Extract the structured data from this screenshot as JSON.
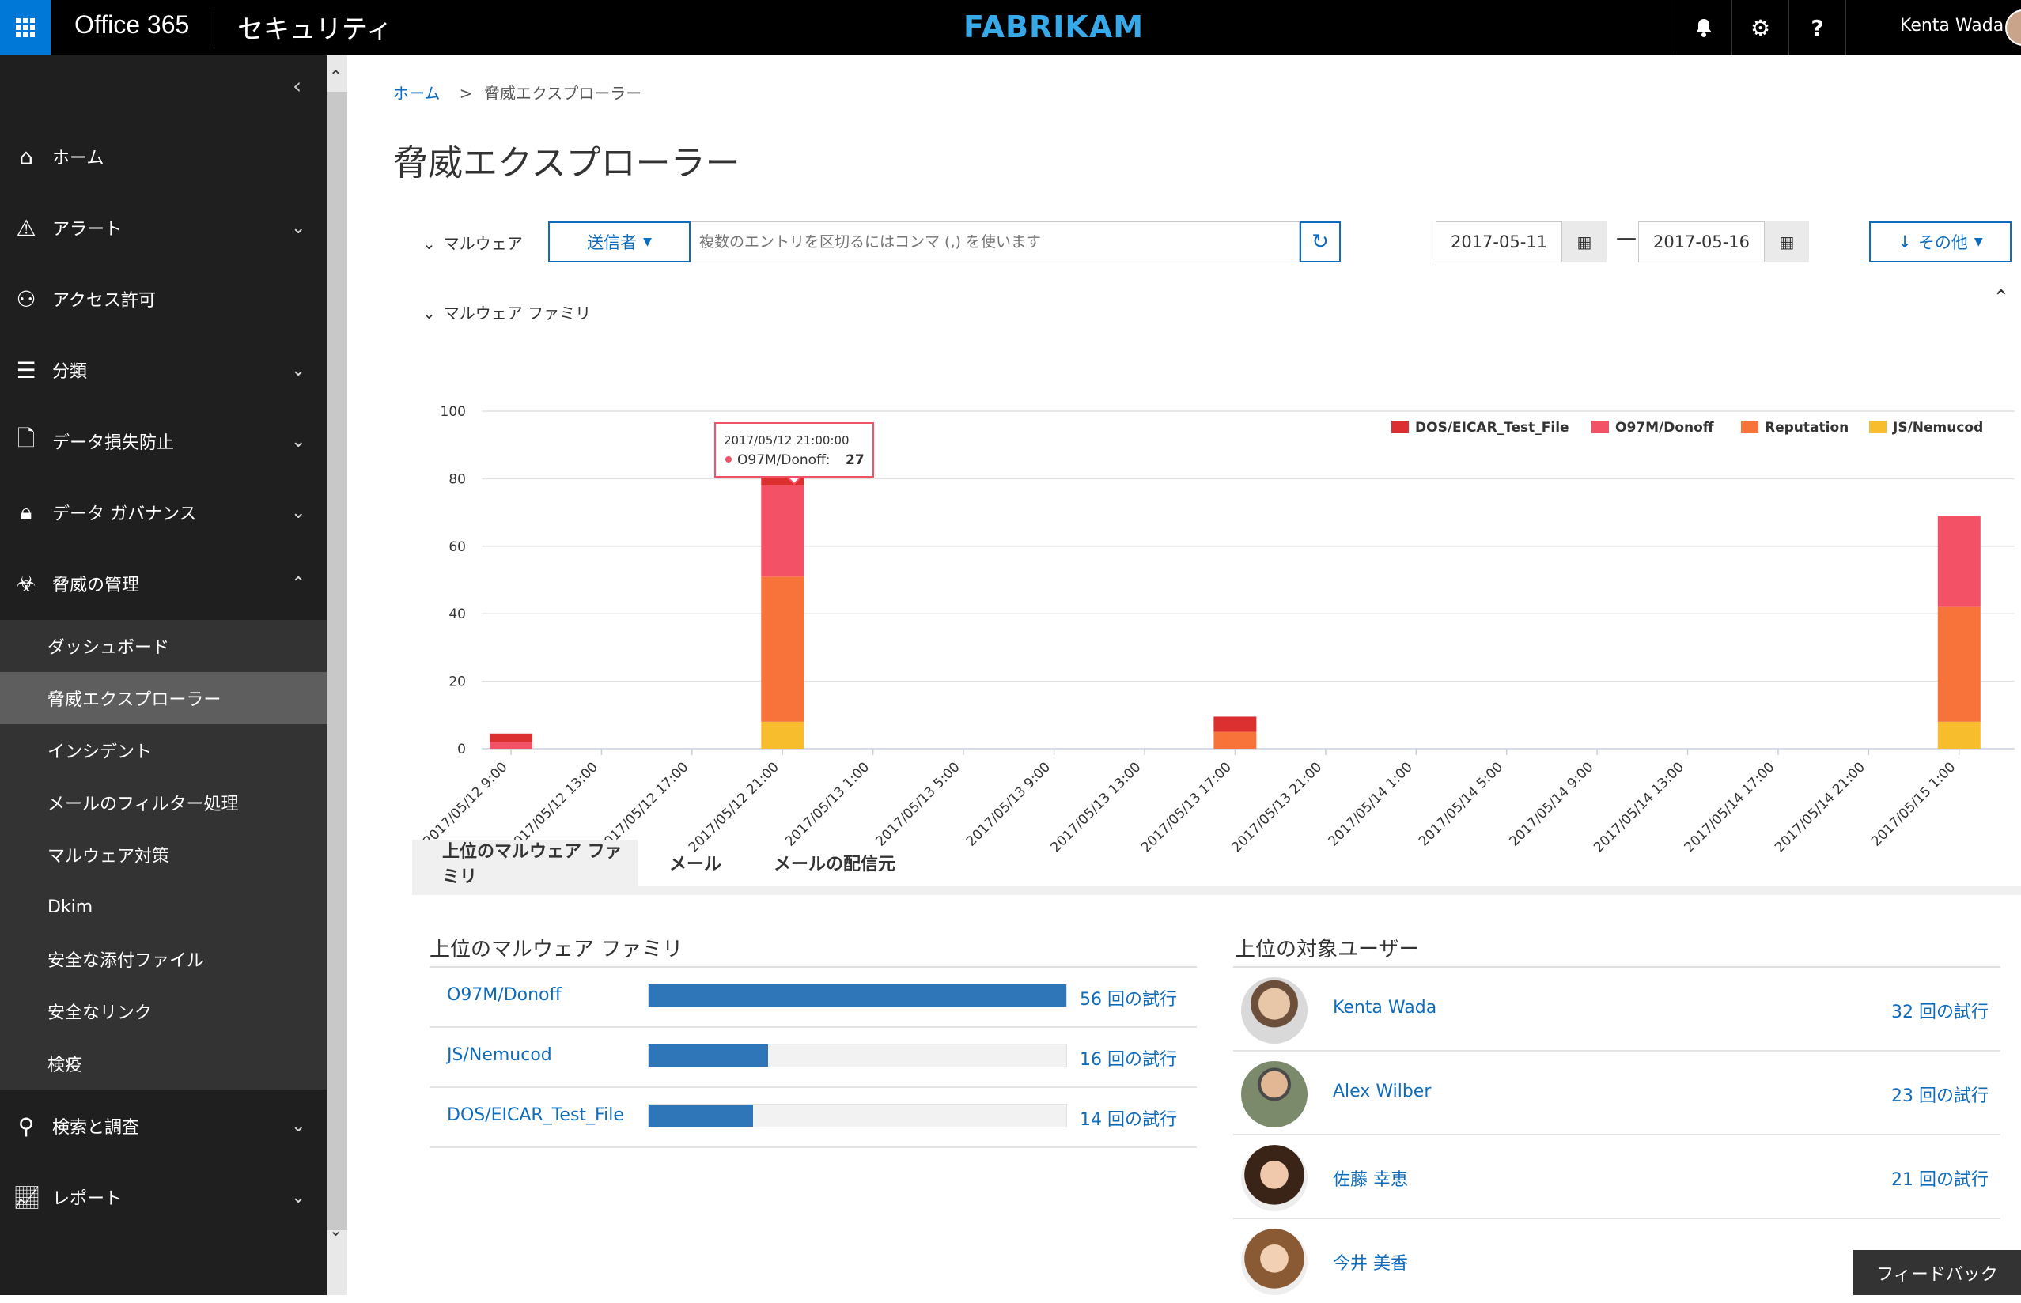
{
  "topbar": {
    "app_name": "Office 365",
    "section_name": "セキュリティ",
    "brand": "FABRIKAM",
    "user_name": "Kenta Wada"
  },
  "sidebar": {
    "items": [
      {
        "label": "ホーム",
        "icon": "home-icon"
      },
      {
        "label": "アラート",
        "icon": "alert-icon"
      },
      {
        "label": "アクセス許可",
        "icon": "people-icon"
      },
      {
        "label": "分類",
        "icon": "list-icon"
      },
      {
        "label": "データ損失防止",
        "icon": "document-lock-icon"
      },
      {
        "label": "データ ガバナンス",
        "icon": "lock-icon"
      },
      {
        "label": "脅威の管理",
        "icon": "biohazard-icon"
      },
      {
        "label": "検索と調査",
        "icon": "search-icon"
      },
      {
        "label": "レポート",
        "icon": "chart-icon"
      }
    ],
    "subitems": [
      "ダッシュボード",
      "脅威エクスプローラー",
      "インシデント",
      "メールのフィルター処理",
      "マルウェア対策",
      "Dkim",
      "安全な添付ファイル",
      "安全なリンク",
      "検疫"
    ],
    "active_subitem": "脅威エクスプローラー"
  },
  "breadcrumb": {
    "home": "ホーム",
    "separator": ">",
    "current": "脅威エクスプローラー"
  },
  "page_title": "脅威エクスプローラー",
  "filter": {
    "toggle_label": "マルウェア",
    "sender_label": "送信者",
    "search_placeholder": "複数のエントリを区切るにはコンマ (,) を使います",
    "date_from": "2017-05-11",
    "date_to": "2017-05-16",
    "more_label": "その他"
  },
  "chart_section_label": "マルウェア ファミリ",
  "chart_data": {
    "type": "bar",
    "stacked": true,
    "categories": [
      "2017/05/12 9:00",
      "2017/05/12 13:00",
      "2017/05/12 17:00",
      "2017/05/12 21:00",
      "2017/05/13 1:00",
      "2017/05/13 5:00",
      "2017/05/13 9:00",
      "2017/05/13 13:00",
      "2017/05/13 17:00",
      "2017/05/13 21:00",
      "2017/05/14 1:00",
      "2017/05/14 5:00",
      "2017/05/14 9:00",
      "2017/05/14 13:00",
      "2017/05/14 17:00",
      "2017/05/14 21:00",
      "2017/05/15 1:00"
    ],
    "series": [
      {
        "name": "JS/Nemucod",
        "color": "#f7bd2d",
        "values": [
          0,
          0,
          0,
          8,
          0,
          0,
          0,
          0,
          0,
          0,
          0,
          0,
          0,
          0,
          0,
          0,
          8
        ]
      },
      {
        "name": "Reputation",
        "color": "#f7733a",
        "values": [
          0,
          0,
          0,
          43,
          0,
          0,
          0,
          0,
          5,
          0,
          0,
          0,
          0,
          0,
          0,
          0,
          34
        ]
      },
      {
        "name": "O97M/Donoff",
        "color": "#f25166",
        "values": [
          2,
          0,
          0,
          27,
          0,
          0,
          0,
          0,
          0,
          0,
          0,
          0,
          0,
          0,
          0,
          0,
          27
        ]
      },
      {
        "name": "DOS/EICAR_Test_File",
        "color": "#dc2f2f",
        "values": [
          2.5,
          0,
          0,
          4,
          0,
          0,
          0,
          0,
          4.5,
          0,
          0,
          0,
          0,
          0,
          0,
          0,
          0
        ]
      }
    ],
    "legend_order": [
      "DOS/EICAR_Test_File",
      "O97M/Donoff",
      "Reputation",
      "JS/Nemucod"
    ],
    "ylim": [
      0,
      100
    ],
    "yticks": [
      0,
      20,
      40,
      60,
      80,
      100
    ],
    "legend_position": "top-right",
    "grid": true,
    "tooltip": {
      "time": "2017/05/12 21:00:00",
      "series": "O97M/Donoff",
      "value": "27"
    }
  },
  "tabs": [
    "上位のマルウェア ファミリ",
    "メール",
    "メールの配信元"
  ],
  "malware_panel": {
    "title": "上位のマルウェア ファミリ",
    "rows": [
      {
        "name": "O97M/Donoff",
        "count": "56 回の試行",
        "value": 56
      },
      {
        "name": "JS/Nemucod",
        "count": "16 回の試行",
        "value": 16
      },
      {
        "name": "DOS/EICAR_Test_File",
        "count": "14 回の試行",
        "value": 14
      }
    ],
    "max": 56
  },
  "users_panel": {
    "title": "上位の対象ユーザー",
    "rows": [
      {
        "name": "Kenta Wada",
        "count": "32 回の試行"
      },
      {
        "name": "Alex Wilber",
        "count": "23 回の試行"
      },
      {
        "name": "佐藤 幸恵",
        "count": "21 回の試行"
      },
      {
        "name": "今井 美香",
        "count": ""
      }
    ]
  },
  "feedback_label": "フィードバック",
  "colors": {
    "accent": "#0f6cbd",
    "brand": "#37a9e8",
    "waffle": "#0078d7",
    "bar": "#2f76b8"
  }
}
